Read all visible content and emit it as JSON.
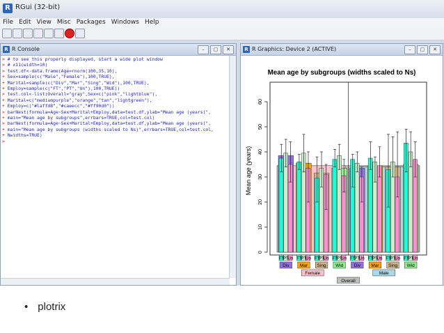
{
  "app": {
    "title": "RGui (32-bit)",
    "menu": [
      "File",
      "Edit",
      "View",
      "Misc",
      "Packages",
      "Windows",
      "Help"
    ],
    "window_controls": [
      "–",
      "▢",
      "✕"
    ]
  },
  "console": {
    "title": "R Console",
    "lines": [
      {
        "prompt": ">",
        "text": " # to see this properly displayed, start a wide plot window"
      },
      {
        "prompt": ">",
        "text": " # x11(width=10)"
      },
      {
        "prompt": ">",
        "text": " test.df<-data.frame(Age=rnorm(100,35,10),"
      },
      {
        "prompt": "+",
        "text": " Sex=sample(c(\"Male\",\"Female\"),100,TRUE),"
      },
      {
        "prompt": "+",
        "text": " Marital=sample(c(\"Div\",\"Mar\",\"Sing\",\"Wid\"),100,TRUE),"
      },
      {
        "prompt": "+",
        "text": " Employ=sample(c(\"FT\",\"PT\",\"Un\"),100,TRUE))"
      },
      {
        "prompt": ">",
        "text": " test.col<-list(Overall=\"gray\",Sex=c(\"pink\",\"lightblue\"),"
      },
      {
        "prompt": "+",
        "text": " Marital=c(\"mediumpurple\",\"orange\",\"tan\",\"lightgreen\"),"
      },
      {
        "prompt": "+",
        "text": " Employ=c(\"#laffd8\",\"#caeecc\",\"#ff90d0\"))"
      },
      {
        "prompt": ">",
        "text": " barNest(formula=Age~Sex+Marital+Employ,data=test.df,ylab=\"Mean age (years)\","
      },
      {
        "prompt": "+",
        "text": " main=\"Mean age by subgroups\",errbars=TRUE,col=test.col)"
      },
      {
        "prompt": ">",
        "text": " barNest(formula=Age~Sex+Marital+Employ,data=test.df,ylab=\"Mean age (years)\","
      },
      {
        "prompt": "+",
        "text": " main=\"Mean age by subgroups (widths scaled to Ns)\",errbars=TRUE,col=test.col,"
      },
      {
        "prompt": "+",
        "text": " Nwidths=TRUE)"
      },
      {
        "prompt": ">",
        "text": ""
      }
    ]
  },
  "graphics": {
    "title": "R Graphics: Device 2 (ACTIVE)"
  },
  "chart_data": {
    "type": "bar",
    "title": "Mean age by subgroups (widths scaled to Ns)",
    "ylabel": "Mean age (years)",
    "xlabel": "",
    "ylim": [
      0,
      65
    ],
    "yticks": [
      0,
      10,
      20,
      30,
      40,
      50,
      60
    ],
    "grid": false,
    "overall": {
      "label": "Overall",
      "value": 34.5,
      "color": "#bebebe"
    },
    "sex": [
      {
        "label": "Female",
        "value": 34.5,
        "color": "#ffc0cb"
      },
      {
        "label": "Male",
        "value": 34.0,
        "color": "#add8e6"
      }
    ],
    "marital": [
      {
        "label": "Div",
        "sex": "Female",
        "value": 38.5,
        "color": "#9370db"
      },
      {
        "label": "Mar",
        "sex": "Female",
        "value": 35.5,
        "color": "#ffa500"
      },
      {
        "label": "Sing",
        "sex": "Female",
        "value": 31.5,
        "color": "#d2b48c"
      },
      {
        "label": "Wid",
        "sex": "Female",
        "value": 33.5,
        "color": "#90ee90"
      },
      {
        "label": "Div",
        "sex": "Male",
        "value": 33.5,
        "color": "#9370db"
      },
      {
        "label": "Mar",
        "sex": "Male",
        "value": 34.5,
        "color": "#ffa500"
      },
      {
        "label": "Sing",
        "sex": "Male",
        "value": 34.0,
        "color": "#d2b48c"
      },
      {
        "label": "Wid",
        "sex": "Male",
        "value": 35.0,
        "color": "#90ee90"
      }
    ],
    "employ_colors": {
      "FT": "#1affd8",
      "PT": "#caeecc",
      "Un": "#ff90d0"
    },
    "employ": [
      {
        "label": "FT",
        "group": 0,
        "value": 37.5,
        "lo": 32,
        "hi": 43
      },
      {
        "label": "PT",
        "group": 0,
        "value": 39.5,
        "lo": 34,
        "hi": 45
      },
      {
        "label": "Un",
        "group": 0,
        "value": 35.0,
        "lo": 28,
        "hi": 44
      },
      {
        "label": "FT",
        "group": 1,
        "value": 36.0,
        "lo": 33,
        "hi": 39
      },
      {
        "label": "PT",
        "group": 1,
        "value": 39.5,
        "lo": 32,
        "hi": 47
      },
      {
        "label": "Un",
        "group": 1,
        "value": 33.5,
        "lo": 20,
        "hi": 40
      },
      {
        "label": "FT",
        "group": 2,
        "value": 29.5,
        "lo": 20,
        "hi": 38
      },
      {
        "label": "PT",
        "group": 2,
        "value": 33.5,
        "lo": 26,
        "hi": 40
      },
      {
        "label": "Un",
        "group": 2,
        "value": 31.0,
        "lo": 17,
        "hi": 35
      },
      {
        "label": "FT",
        "group": 3,
        "value": 37.0,
        "lo": 34,
        "hi": 41
      },
      {
        "label": "PT",
        "group": 3,
        "value": 38.5,
        "lo": 33,
        "hi": 43
      },
      {
        "label": "Un",
        "group": 3,
        "value": 30.5,
        "lo": 24,
        "hi": 37
      },
      {
        "label": "FT",
        "group": 4,
        "value": 37.0,
        "lo": 26,
        "hi": 39
      },
      {
        "label": "PT",
        "group": 4,
        "value": 35.5,
        "lo": 32,
        "hi": 40
      },
      {
        "label": "Un",
        "group": 4,
        "value": 30.0,
        "lo": 20,
        "hi": 34
      },
      {
        "label": "FT",
        "group": 5,
        "value": 37.5,
        "lo": 33,
        "hi": 44
      },
      {
        "label": "PT",
        "group": 5,
        "value": 36.0,
        "lo": 28,
        "hi": 38
      },
      {
        "label": "Un",
        "group": 5,
        "value": 34.5,
        "lo": 30,
        "hi": 42
      },
      {
        "label": "FT",
        "group": 6,
        "value": 33.0,
        "lo": 18,
        "hi": 47
      },
      {
        "label": "PT",
        "group": 6,
        "value": 36.0,
        "lo": 30,
        "hi": 46
      },
      {
        "label": "Un",
        "group": 6,
        "value": 30.0,
        "lo": 22,
        "hi": 48
      },
      {
        "label": "FT",
        "group": 7,
        "value": 43.5,
        "lo": 32,
        "hi": 49
      },
      {
        "label": "PT",
        "group": 7,
        "value": 40.0,
        "lo": 34,
        "hi": 48
      },
      {
        "label": "Un",
        "group": 7,
        "value": 37.0,
        "lo": 30,
        "hi": 44
      }
    ]
  },
  "caption": {
    "bullet": "•",
    "text": "plotrix"
  }
}
